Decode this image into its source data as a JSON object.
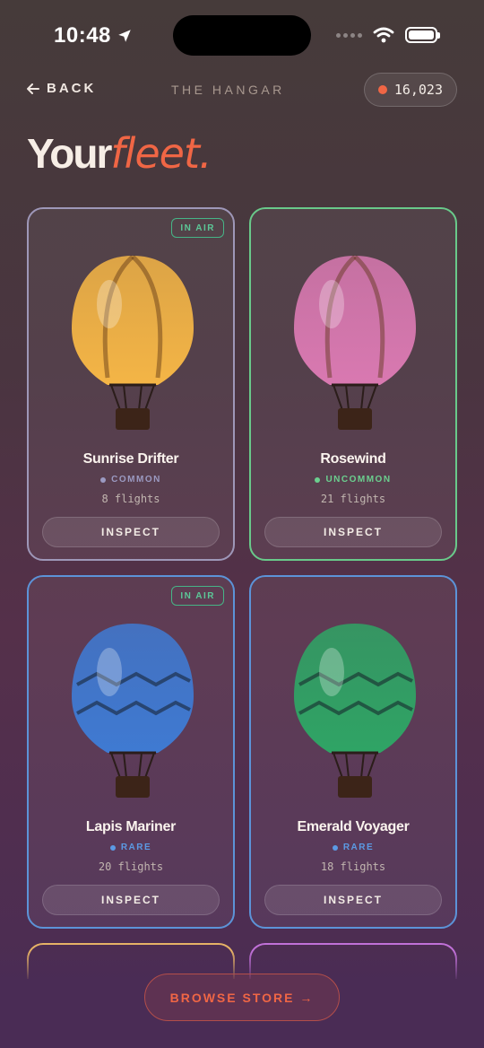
{
  "status": {
    "time": "10:48"
  },
  "header": {
    "back_label": "BACK",
    "section_title": "THE HANGAR",
    "balance": "16,023"
  },
  "title": {
    "plain": "Your",
    "accent": "fleet."
  },
  "fleet": [
    {
      "name": "Sunrise Drifter",
      "rarity": "COMMON",
      "rarity_color": "#9b9ac2",
      "border": "#9e97b8",
      "flights": "8 flights",
      "in_air": true,
      "badge": "IN AIR",
      "inspect": "INSPECT",
      "balloon_color": "#f4b546",
      "pattern": "stripes"
    },
    {
      "name": "Rosewind",
      "rarity": "UNCOMMON",
      "rarity_color": "#6bd08f",
      "border": "#69c98a",
      "flights": "21 flights",
      "in_air": false,
      "badge": "",
      "inspect": "INSPECT",
      "balloon_color": "#d979b1",
      "pattern": "stripes"
    },
    {
      "name": "Lapis Mariner",
      "rarity": "RARE",
      "rarity_color": "#5b9ae4",
      "border": "#5c93d8",
      "flights": "20 flights",
      "in_air": true,
      "badge": "IN AIR",
      "inspect": "INSPECT",
      "balloon_color": "#3f7ad2",
      "pattern": "zigzag"
    },
    {
      "name": "Emerald Voyager",
      "rarity": "RARE",
      "rarity_color": "#5b9ae4",
      "border": "#5c93d8",
      "flights": "18 flights",
      "in_air": false,
      "badge": "",
      "inspect": "INSPECT",
      "balloon_color": "#2fa465",
      "pattern": "zigzag"
    }
  ],
  "peek_borders": [
    "#e6b266",
    "#c171d8"
  ],
  "browse_store": "BROWSE STORE →"
}
